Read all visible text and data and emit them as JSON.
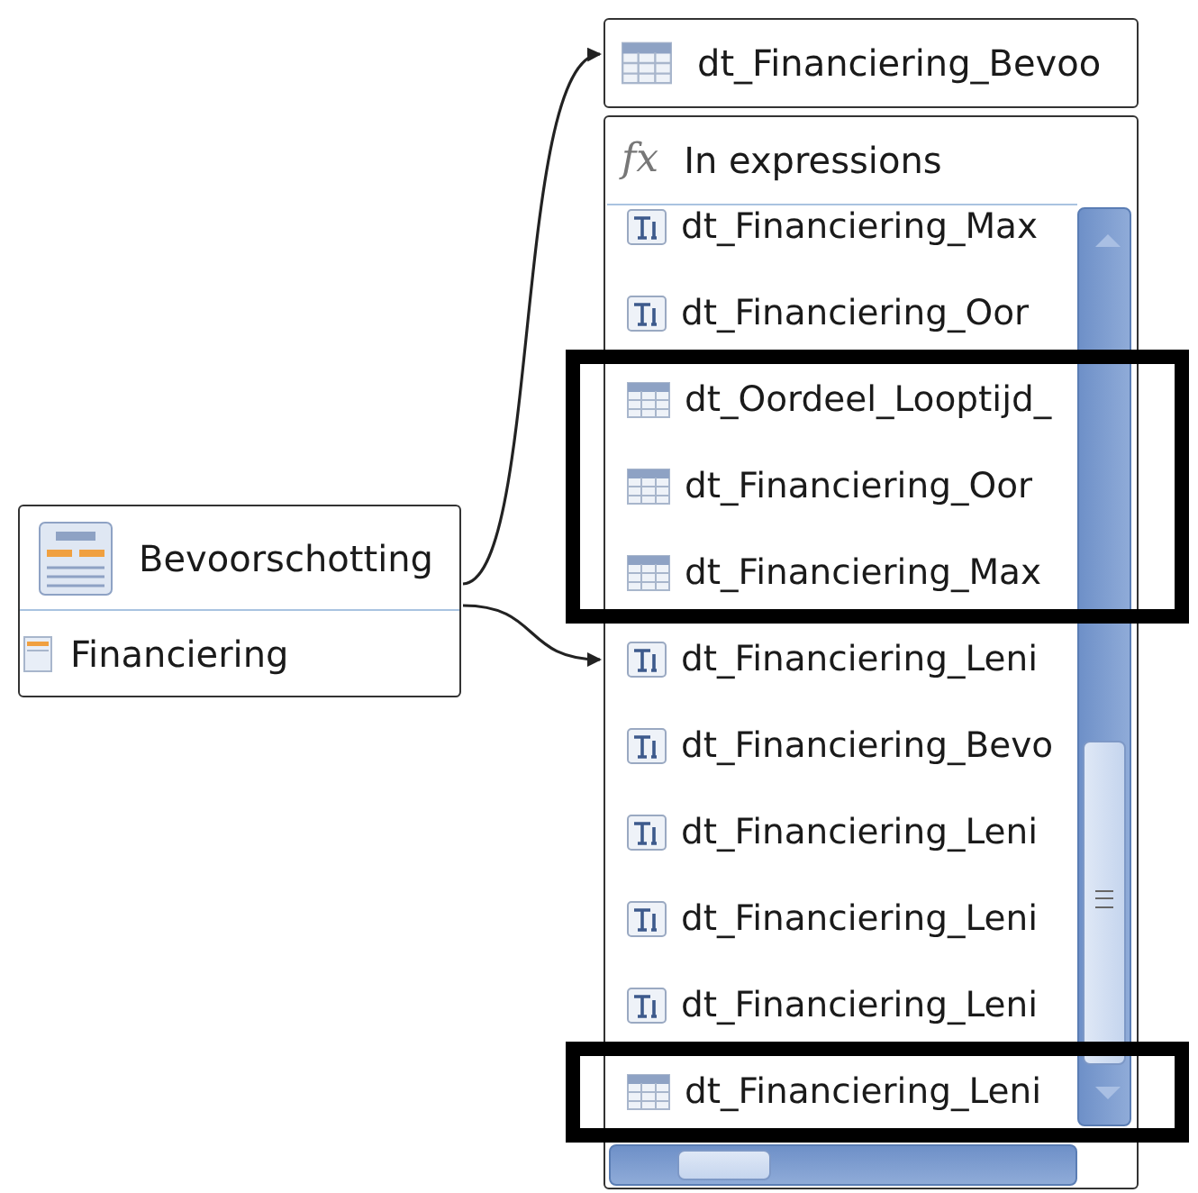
{
  "entity": {
    "title": "Bevoorschotting",
    "attribute": "Financiering"
  },
  "target": {
    "label": "dt_Financiering_Bevoo"
  },
  "usages": {
    "header_icon": "fx",
    "header": "In expressions",
    "items": [
      {
        "kind": "field",
        "label": "dt_Financiering_Max",
        "highlighted": false
      },
      {
        "kind": "field",
        "label": "dt_Financiering_Oor",
        "highlighted": false
      },
      {
        "kind": "table",
        "label": "dt_Oordeel_Looptijd_",
        "highlighted": true
      },
      {
        "kind": "table",
        "label": "dt_Financiering_Oor",
        "highlighted": true
      },
      {
        "kind": "table",
        "label": "dt_Financiering_Max",
        "highlighted": true
      },
      {
        "kind": "field",
        "label": "dt_Financiering_Leni",
        "highlighted": false
      },
      {
        "kind": "field",
        "label": "dt_Financiering_Bevo",
        "highlighted": false
      },
      {
        "kind": "field",
        "label": "dt_Financiering_Leni",
        "highlighted": false
      },
      {
        "kind": "field",
        "label": "dt_Financiering_Leni",
        "highlighted": false
      },
      {
        "kind": "field",
        "label": "dt_Financiering_Leni",
        "highlighted": false
      },
      {
        "kind": "table",
        "label": "dt_Financiering_Leni",
        "highlighted": true
      }
    ]
  }
}
